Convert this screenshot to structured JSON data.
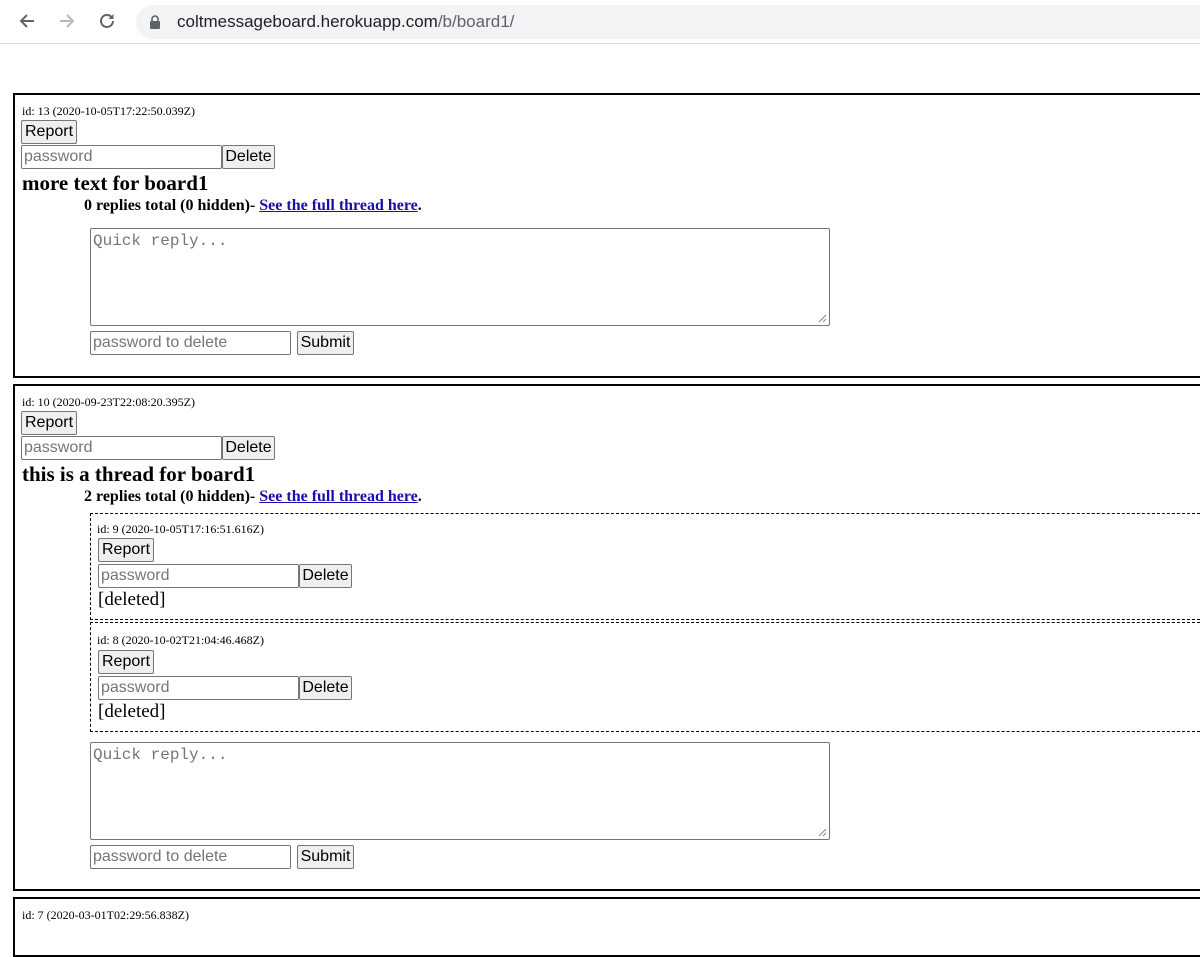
{
  "browser": {
    "url_host": "coltmessageboard.herokuapp.com",
    "url_path": "/b/board1/"
  },
  "threads": [
    {
      "meta": "id: 13 (2020-10-05T17:22:50.039Z)",
      "report_label": "Report",
      "password_placeholder": "password",
      "delete_label": "Delete",
      "title": "more text for board1",
      "summary": "0 replies total (0 hidden)- ",
      "full_thread_link": "See the full thread here",
      "summary_end": ".",
      "quick_reply_placeholder": "Quick reply...",
      "reply_password_placeholder": "password to delete",
      "submit_label": "Submit"
    },
    {
      "meta": "id: 10 (2020-09-23T22:08:20.395Z)",
      "report_label": "Report",
      "password_placeholder": "password",
      "delete_label": "Delete",
      "title": "this is a thread for board1",
      "summary": "2 replies total (0 hidden)- ",
      "full_thread_link": "See the full thread here",
      "summary_end": ".",
      "replies": [
        {
          "meta": "id: 9 (2020-10-05T17:16:51.616Z)",
          "report_label": "Report",
          "password_placeholder": "password",
          "delete_label": "Delete",
          "text": "[deleted]"
        },
        {
          "meta": "id: 8 (2020-10-02T21:04:46.468Z)",
          "report_label": "Report",
          "password_placeholder": "password",
          "delete_label": "Delete",
          "text": "[deleted]"
        }
      ],
      "quick_reply_placeholder": "Quick reply...",
      "reply_password_placeholder": "password to delete",
      "submit_label": "Submit"
    },
    {
      "meta": "id: 7 (2020-03-01T02:29:56.838Z)"
    }
  ]
}
